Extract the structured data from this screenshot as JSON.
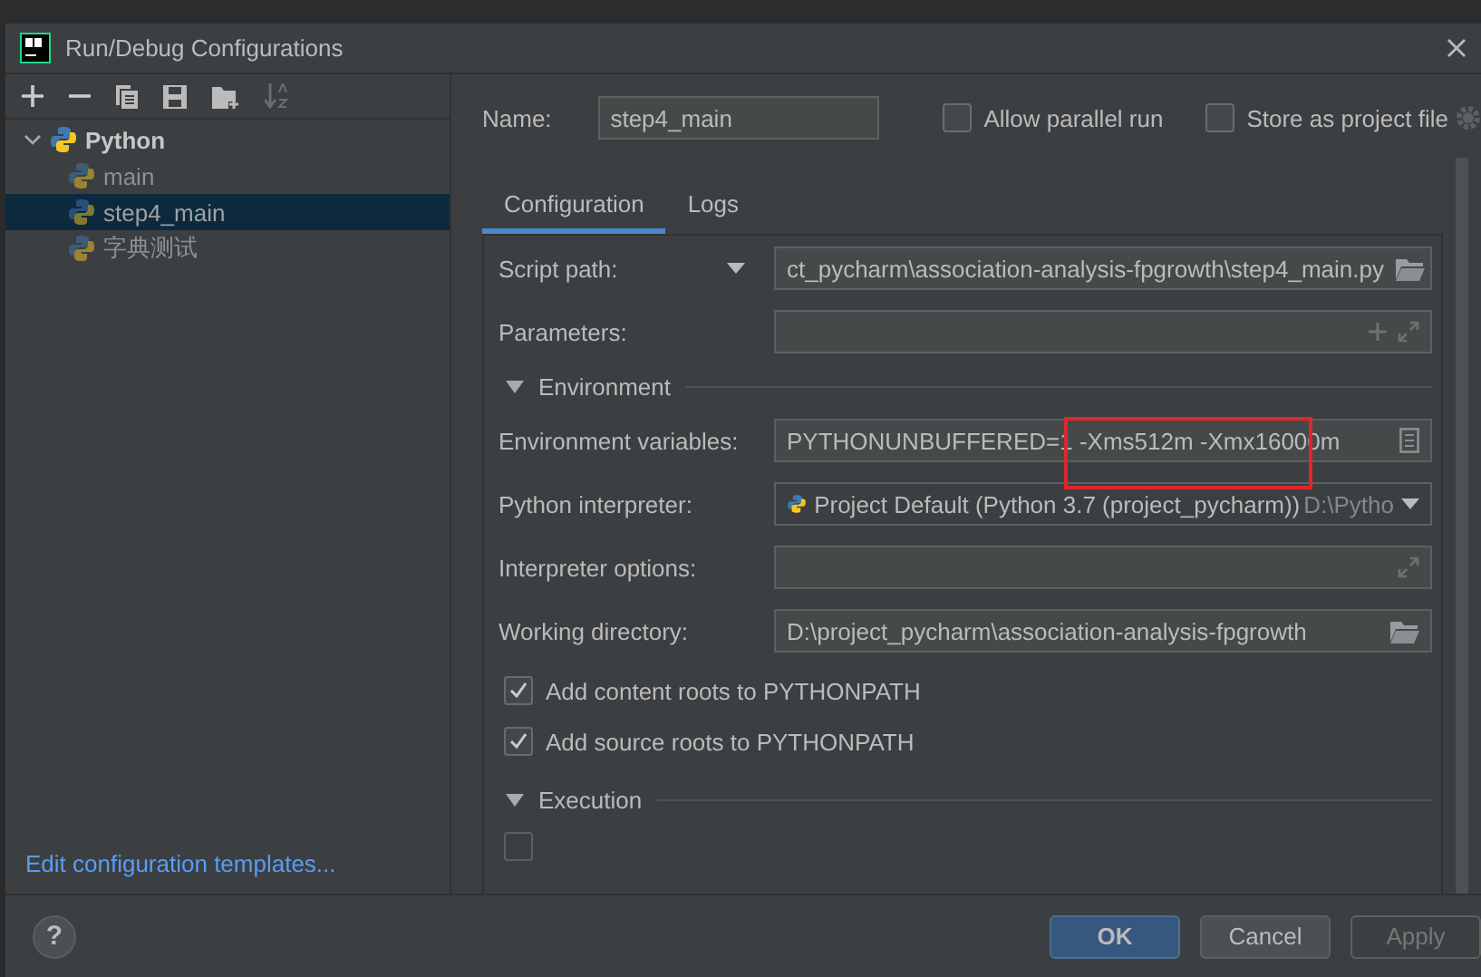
{
  "window": {
    "title": "Run/Debug Configurations"
  },
  "tree": [
    {
      "label": "Python",
      "expanded": true,
      "selected": false,
      "children": [
        {
          "label": "main",
          "selected": false
        },
        {
          "label": "step4_main",
          "selected": true
        },
        {
          "label": "字典测试",
          "selected": false
        }
      ]
    }
  ],
  "templates_link": "Edit configuration templates...",
  "name": {
    "label": "Name:",
    "value": "step4_main"
  },
  "options": [
    {
      "label": "Allow parallel run",
      "checked": false
    },
    {
      "label": "Store as project file",
      "checked": false
    }
  ],
  "tabs": [
    {
      "label": "Configuration",
      "selected": true
    },
    {
      "label": "Logs",
      "selected": false
    }
  ],
  "fields": [
    {
      "kind": "script",
      "label": "Script path:",
      "value": "ct_pycharm\\association-analysis-fpgrowth\\step4_main.py"
    },
    {
      "kind": "params",
      "label": "Parameters:"
    }
  ],
  "environment": {
    "title": "Environment",
    "expanded": true,
    "fields": [
      {
        "kind": "env",
        "label": "Environment variables:",
        "value": "PYTHONUNBUFFERED=1 -Xms512m -Xmx16000m"
      },
      {
        "kind": "interpreter",
        "label": "Python interpreter:",
        "value": "Project Default (Python 3.7 (project_pycharm))",
        "hint": "D:\\Pytho"
      },
      {
        "kind": "expand",
        "label": "Interpreter options:"
      },
      {
        "kind": "browse",
        "label": "Working directory:",
        "value": "D:\\project_pycharm\\association-analysis-fpgrowth"
      }
    ],
    "checkboxes": [
      {
        "label": "Add content roots to PYTHONPATH",
        "checked": true
      },
      {
        "label": "Add source roots to PYTHONPATH",
        "checked": true
      }
    ]
  },
  "execution": {
    "title": "Execution",
    "expanded": true,
    "checkboxes": [
      {
        "checked": false
      }
    ]
  },
  "help": "?",
  "buttons": [
    {
      "label": "OK",
      "kind": "primary",
      "disabled": false
    },
    {
      "label": "Cancel",
      "kind": "normal",
      "disabled": false
    },
    {
      "label": "Apply",
      "kind": "normal",
      "disabled": true
    }
  ]
}
